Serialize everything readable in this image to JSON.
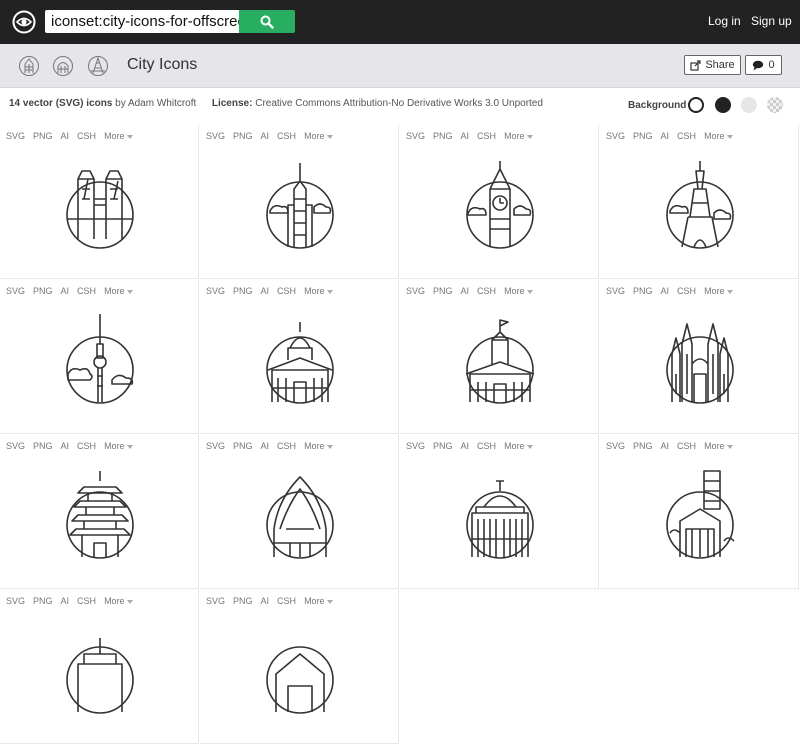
{
  "header": {
    "search_value": "iconset:city-icons-for-offscreen-",
    "login": "Log in",
    "signup": "Sign up"
  },
  "subheader": {
    "title": "City Icons",
    "share_label": "Share",
    "comments_count": "0"
  },
  "info": {
    "count_text": "14 vector (SVG) icons",
    "author_text": " by Adam Whitcroft",
    "license_label": "License:",
    "license_text": " Creative Commons Attribution-No Derivative Works 3.0 Unported",
    "background_label": "Background"
  },
  "download_labels": [
    "SVG",
    "PNG",
    "AI",
    "CSH",
    "More"
  ],
  "icons": [
    {
      "name": "tower-bridge-icon"
    },
    {
      "name": "skyscraper-icon"
    },
    {
      "name": "big-ben-icon"
    },
    {
      "name": "eiffel-tower-icon"
    },
    {
      "name": "tv-tower-icon"
    },
    {
      "name": "domed-palace-icon"
    },
    {
      "name": "town-hall-icon"
    },
    {
      "name": "sagrada-familia-icon"
    },
    {
      "name": "pagoda-icon"
    },
    {
      "name": "opera-house-icon"
    },
    {
      "name": "capitol-icon"
    },
    {
      "name": "windmill-icon"
    },
    {
      "name": "city-icon-13"
    },
    {
      "name": "city-icon-14"
    }
  ],
  "colors": {
    "topbar": "#222222",
    "search_button": "#27ae60",
    "subheader": "#e5e5ea"
  }
}
